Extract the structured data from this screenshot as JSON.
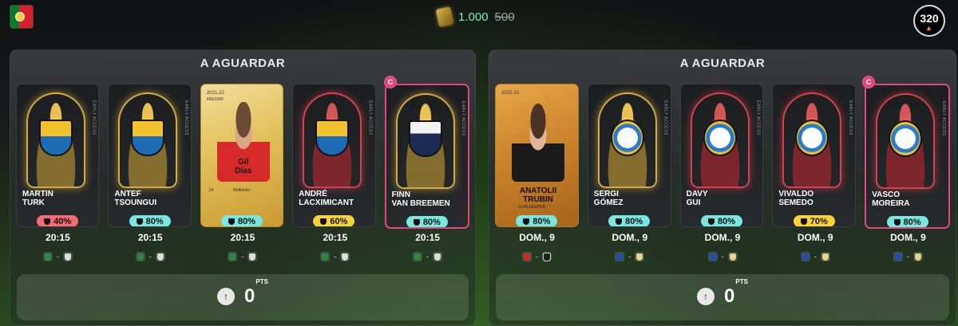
{
  "header": {
    "balance": "1.000",
    "balance_old": "500",
    "streak": "320",
    "colors": {
      "accent_green": "#7ef0b4",
      "pink": "#e5457f"
    }
  },
  "panels": [
    {
      "title": "A AGUARDAR",
      "cards": [
        {
          "name1": "MARTIN",
          "name2": "TURK",
          "score": "40%",
          "score_color": "red",
          "time": "20:15"
        },
        {
          "name1": "ANTEF",
          "name2": "TSOUNGUI",
          "score": "80%",
          "score_color": "teal",
          "time": "20:15"
        },
        {
          "name1": "Gil",
          "name2": "Dias",
          "score": "80%",
          "score_color": "teal",
          "time": "20:15",
          "year": "2021-22",
          "serial": "450/1000",
          "pos_num": "24",
          "pos_label": "Midfielder"
        },
        {
          "name1": "ANDRÉ",
          "name2": "LACXIMICANT",
          "score": "60%",
          "score_color": "yellow",
          "time": "20:15"
        },
        {
          "name1": "FINN",
          "name2": "VAN BREEMEN",
          "score": "80%",
          "score_color": "teal",
          "time": "20:15",
          "captain": "C"
        }
      ],
      "points": "0",
      "points_unit": "PTS"
    },
    {
      "title": "A AGUARDAR",
      "cards": [
        {
          "name1": "ANATOLII",
          "name2": "TRUBIN",
          "score": "80%",
          "score_color": "teal",
          "time": "DOM., 9",
          "year": "2022-23",
          "pos_label": "GOALKEEPER"
        },
        {
          "name1": "SERGI",
          "name2": "GÓMEZ",
          "score": "80%",
          "score_color": "teal",
          "time": "DOM., 9"
        },
        {
          "name1": "DAVY",
          "name2": "GUI",
          "score": "80%",
          "score_color": "teal",
          "time": "DOM., 9"
        },
        {
          "name1": "VIVALDO",
          "name2": "SEMEDO",
          "score": "70%",
          "score_color": "yellow",
          "time": "DOM., 9"
        },
        {
          "name1": "VASCO",
          "name2": "MOREIRA",
          "score": "80%",
          "score_color": "teal",
          "time": "DOM., 9",
          "captain": "C"
        }
      ],
      "points": "0",
      "points_unit": "PTS"
    }
  ],
  "icons": [
    "flag-portugal-icon",
    "coin-icon",
    "flame-icon",
    "trophy-icon",
    "arrow-up-icon",
    "club-crest-icon"
  ]
}
